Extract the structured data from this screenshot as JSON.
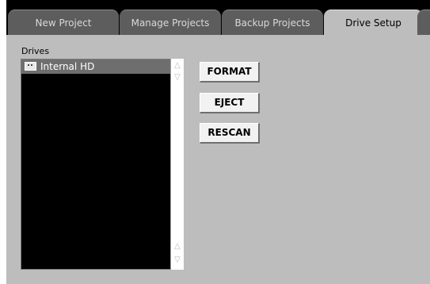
{
  "tabs": [
    {
      "label": "New Project",
      "active": false
    },
    {
      "label": "Manage Projects",
      "active": false
    },
    {
      "label": "Backup Projects",
      "active": false
    },
    {
      "label": "Drive Setup",
      "active": true
    }
  ],
  "drives_panel": {
    "label": "Drives",
    "items": [
      {
        "name": "Internal HD",
        "icon": "hard-drive-icon",
        "selected": true
      }
    ]
  },
  "actions": {
    "format_label": "FORMAT",
    "eject_label": "EJECT",
    "rescan_label": "RESCAN"
  },
  "scroll_glyphs": {
    "up": "△",
    "down": "▽"
  },
  "colors": {
    "panel": "#bdbdbd",
    "tab_inactive": "#5d5d5d",
    "list_background": "#000000",
    "selected_row": "#6e6e6e"
  }
}
